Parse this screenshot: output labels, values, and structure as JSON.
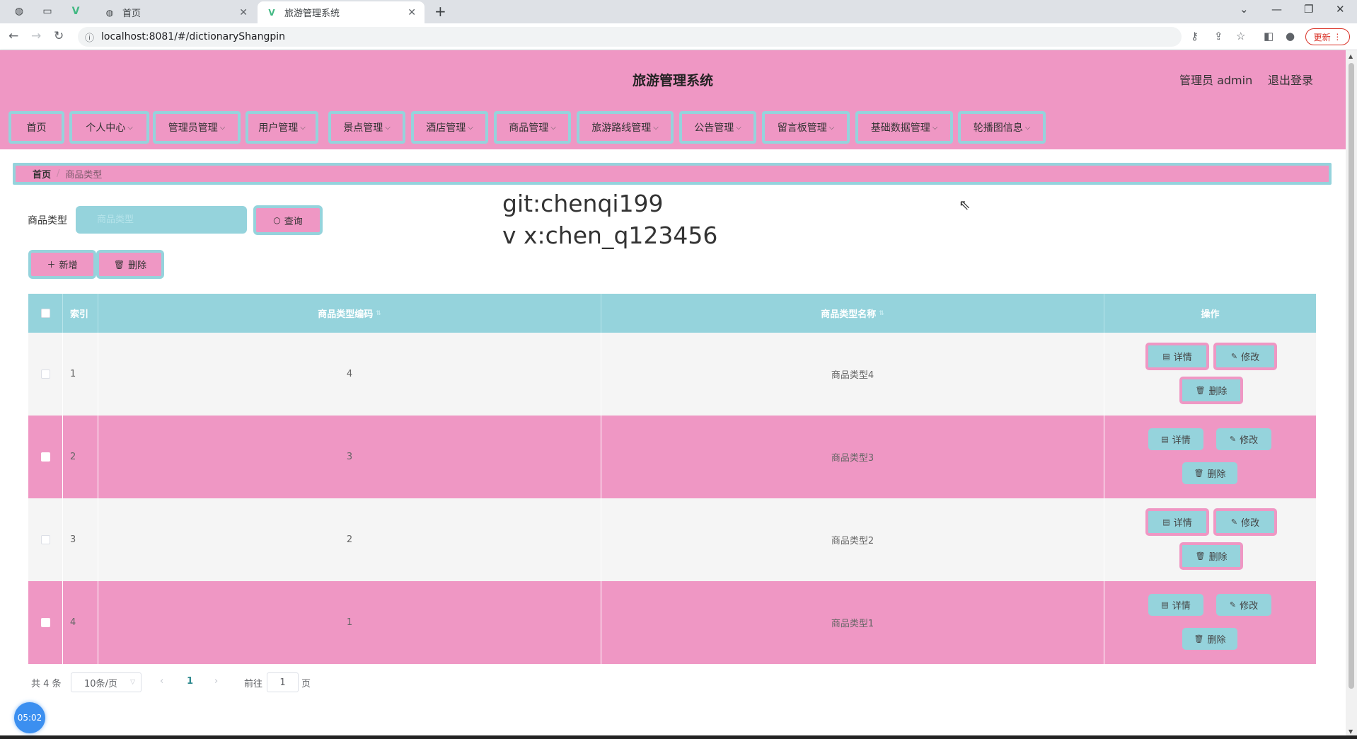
{
  "browser": {
    "tabs": [
      {
        "title": "首页",
        "active": false
      },
      {
        "title": "旅游管理系统",
        "active": true
      }
    ],
    "url": "localhost:8081/#/dictionaryShangpin",
    "update_label": "更新"
  },
  "header": {
    "title": "旅游管理系统",
    "user": "管理员 admin",
    "logout": "退出登录"
  },
  "menu": [
    {
      "label": "首页",
      "dropdown": false
    },
    {
      "label": "个人中心",
      "dropdown": true
    },
    {
      "label": "管理员管理",
      "dropdown": true
    },
    {
      "label": "用户管理",
      "dropdown": true
    },
    {
      "label": "景点管理",
      "dropdown": true
    },
    {
      "label": "酒店管理",
      "dropdown": true
    },
    {
      "label": "商品管理",
      "dropdown": true
    },
    {
      "label": "旅游路线管理",
      "dropdown": true
    },
    {
      "label": "公告管理",
      "dropdown": true
    },
    {
      "label": "留言板管理",
      "dropdown": true
    },
    {
      "label": "基础数据管理",
      "dropdown": true
    },
    {
      "label": "轮播图信息",
      "dropdown": true
    }
  ],
  "breadcrumb": {
    "home": "首页",
    "current": "商品类型"
  },
  "watermark": {
    "line1": "git:chenqi199",
    "line2": "v x:chen_q123456"
  },
  "search": {
    "label": "商品类型",
    "placeholder": "商品类型",
    "value": "",
    "query_button": "查询"
  },
  "toolbar": {
    "add": "新增",
    "delete": "删除"
  },
  "table": {
    "columns": [
      "索引",
      "商品类型编码",
      "商品类型名称",
      "操作"
    ],
    "rows": [
      {
        "index": "1",
        "code": "4",
        "name": "商品类型4"
      },
      {
        "index": "2",
        "code": "3",
        "name": "商品类型3"
      },
      {
        "index": "3",
        "code": "2",
        "name": "商品类型2"
      },
      {
        "index": "4",
        "code": "1",
        "name": "商品类型1"
      }
    ],
    "actions": {
      "detail": "详情",
      "edit": "修改",
      "delete": "删除"
    }
  },
  "pagination": {
    "total": "共 4 条",
    "page_size": "10条/页",
    "current_page": "1",
    "goto_prefix": "前往",
    "goto_value": "1",
    "goto_suffix": "页"
  },
  "timer": "05:02",
  "colors": {
    "pink": "#ef97c4",
    "teal": "#95d3dc"
  }
}
